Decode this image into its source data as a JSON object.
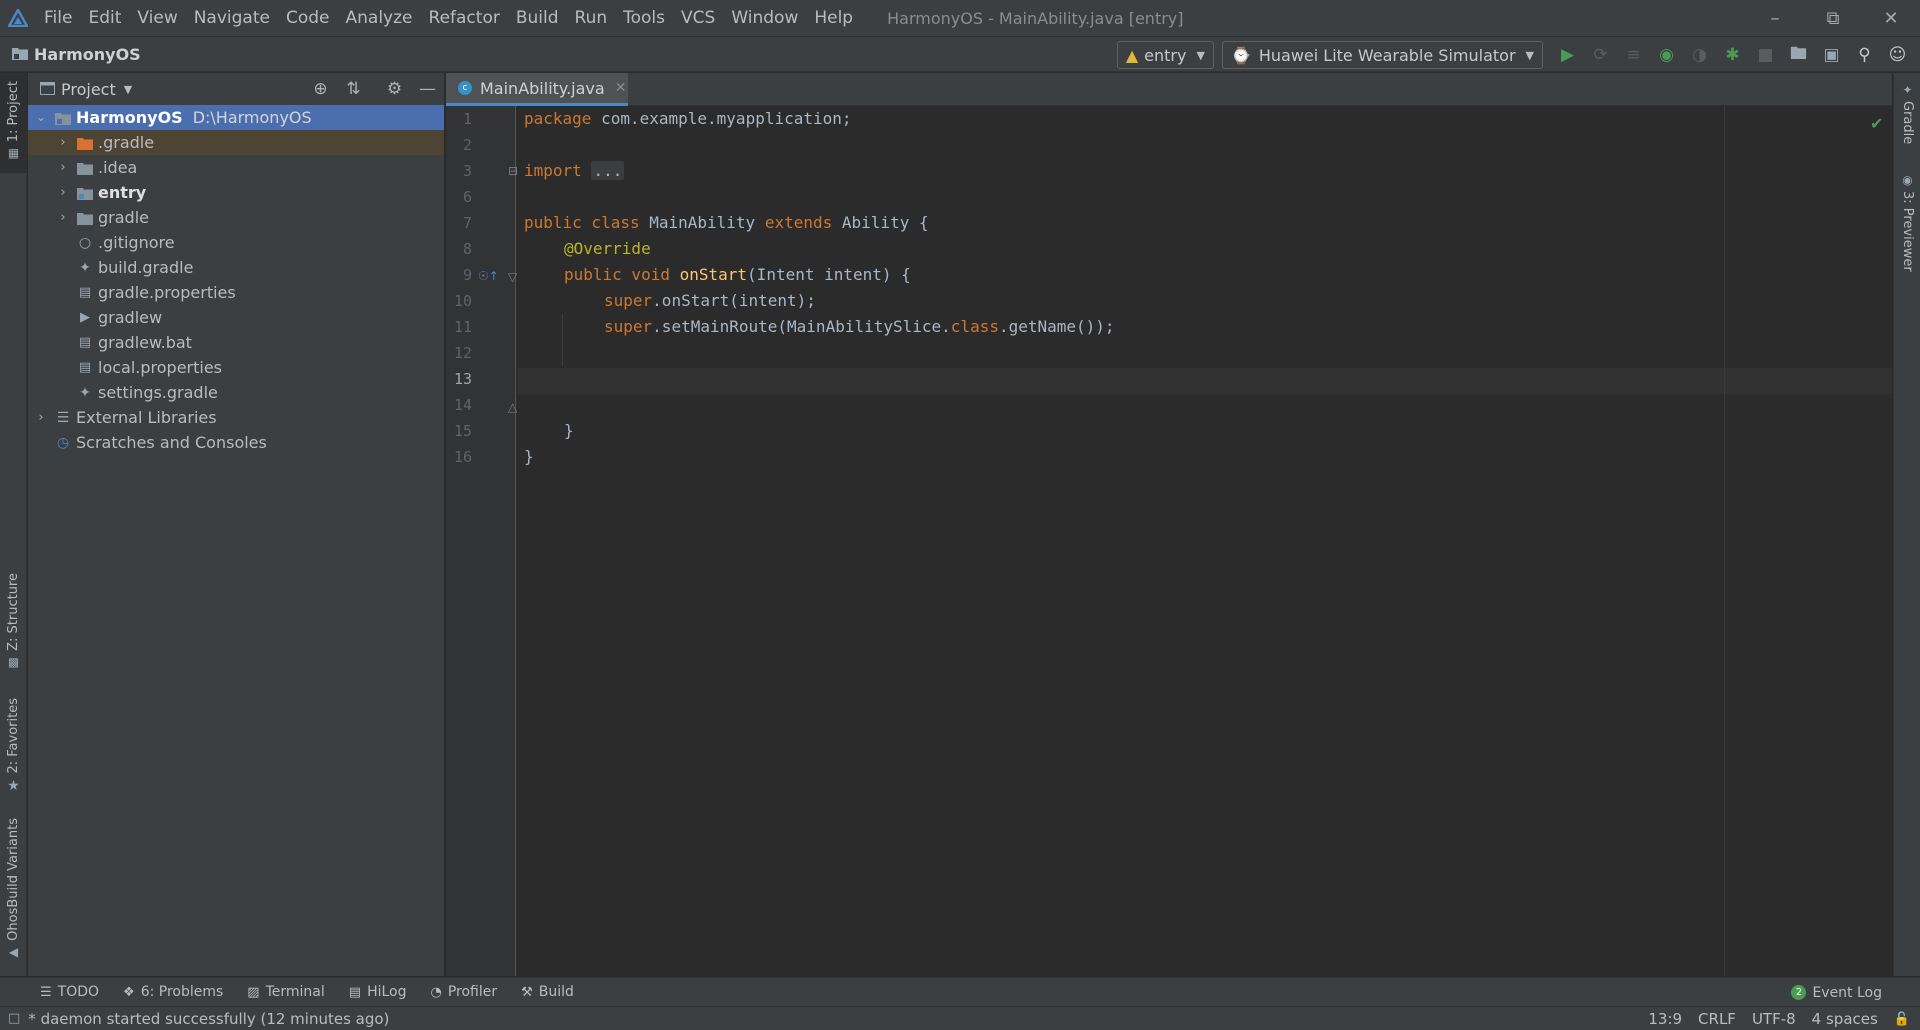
{
  "menu": [
    "File",
    "Edit",
    "View",
    "Navigate",
    "Code",
    "Analyze",
    "Refactor",
    "Build",
    "Run",
    "Tools",
    "VCS",
    "Window",
    "Help"
  ],
  "window_title": "HarmonyOS - MainAbility.java [entry]",
  "navbar": {
    "project": "HarmonyOS",
    "run_config": "entry",
    "device": "Huawei Lite Wearable Simulator"
  },
  "left_strip": {
    "project": "1: Project",
    "structure": "Z: Structure",
    "favorites": "2: Favorites",
    "build_variants": "OhosBuild Variants"
  },
  "right_strip": {
    "gradle": "Gradle",
    "previewer": "3: Previewer"
  },
  "project_panel": {
    "title": "Project",
    "root": {
      "name": "HarmonyOS",
      "path": "D:\\HarmonyOS"
    },
    "items": [
      {
        "name": ".gradle"
      },
      {
        "name": ".idea"
      },
      {
        "name": "entry"
      },
      {
        "name": "gradle"
      },
      {
        "name": ".gitignore"
      },
      {
        "name": "build.gradle"
      },
      {
        "name": "gradle.properties"
      },
      {
        "name": "gradlew"
      },
      {
        "name": "gradlew.bat"
      },
      {
        "name": "local.properties"
      },
      {
        "name": "settings.gradle"
      }
    ],
    "external_libraries": "External Libraries",
    "scratches": "Scratches and Consoles"
  },
  "editor": {
    "tab_label": "MainAbility.java",
    "line_numbers": [
      "1",
      "2",
      "3",
      "6",
      "7",
      "8",
      "9",
      "10",
      "11",
      "12",
      "13",
      "14",
      "15",
      "16"
    ],
    "current_line": "13",
    "code": {
      "l1_kw": "package",
      "l1_rest": " com.example.myapplication;",
      "l3_kw": "import",
      "l3_fold": "...",
      "l7_kw1": "public class",
      "l7_name": " MainAbility ",
      "l7_kw2": "extends",
      "l7_rest": " Ability {",
      "l8_ann": "@Override",
      "l9_kw": "public void",
      "l9_fn": "onStart",
      "l9_rest": "(Intent intent) {",
      "l10_kw": "super",
      "l10_rest": ".onStart(intent);",
      "l11_kw": "super",
      "l11_rest1": ".setMainRoute(MainAbilitySlice.",
      "l11_kw2": "class",
      "l11_rest2": ".getName());",
      "l14": "}",
      "l15": "}"
    }
  },
  "bottom_tools": [
    {
      "label": "TODO",
      "icon": "list-icon"
    },
    {
      "label": "6: Problems",
      "icon": "info-icon"
    },
    {
      "label": "Terminal",
      "icon": "terminal-icon"
    },
    {
      "label": "HiLog",
      "icon": "log-icon"
    },
    {
      "label": "Profiler",
      "icon": "gauge-icon"
    },
    {
      "label": "Build",
      "icon": "hammer-icon"
    }
  ],
  "event_log": {
    "label": "Event Log",
    "count": "2"
  },
  "status": {
    "message": "* daemon started successfully (12 minutes ago)",
    "position": "13:9",
    "line_sep": "CRLF",
    "encoding": "UTF-8",
    "indent": "4 spaces"
  },
  "colors": {
    "accent": "#4b6eaf",
    "run": "#499c54",
    "keyword": "#cc7832",
    "annotation": "#bbb529",
    "function": "#ffc66d"
  }
}
